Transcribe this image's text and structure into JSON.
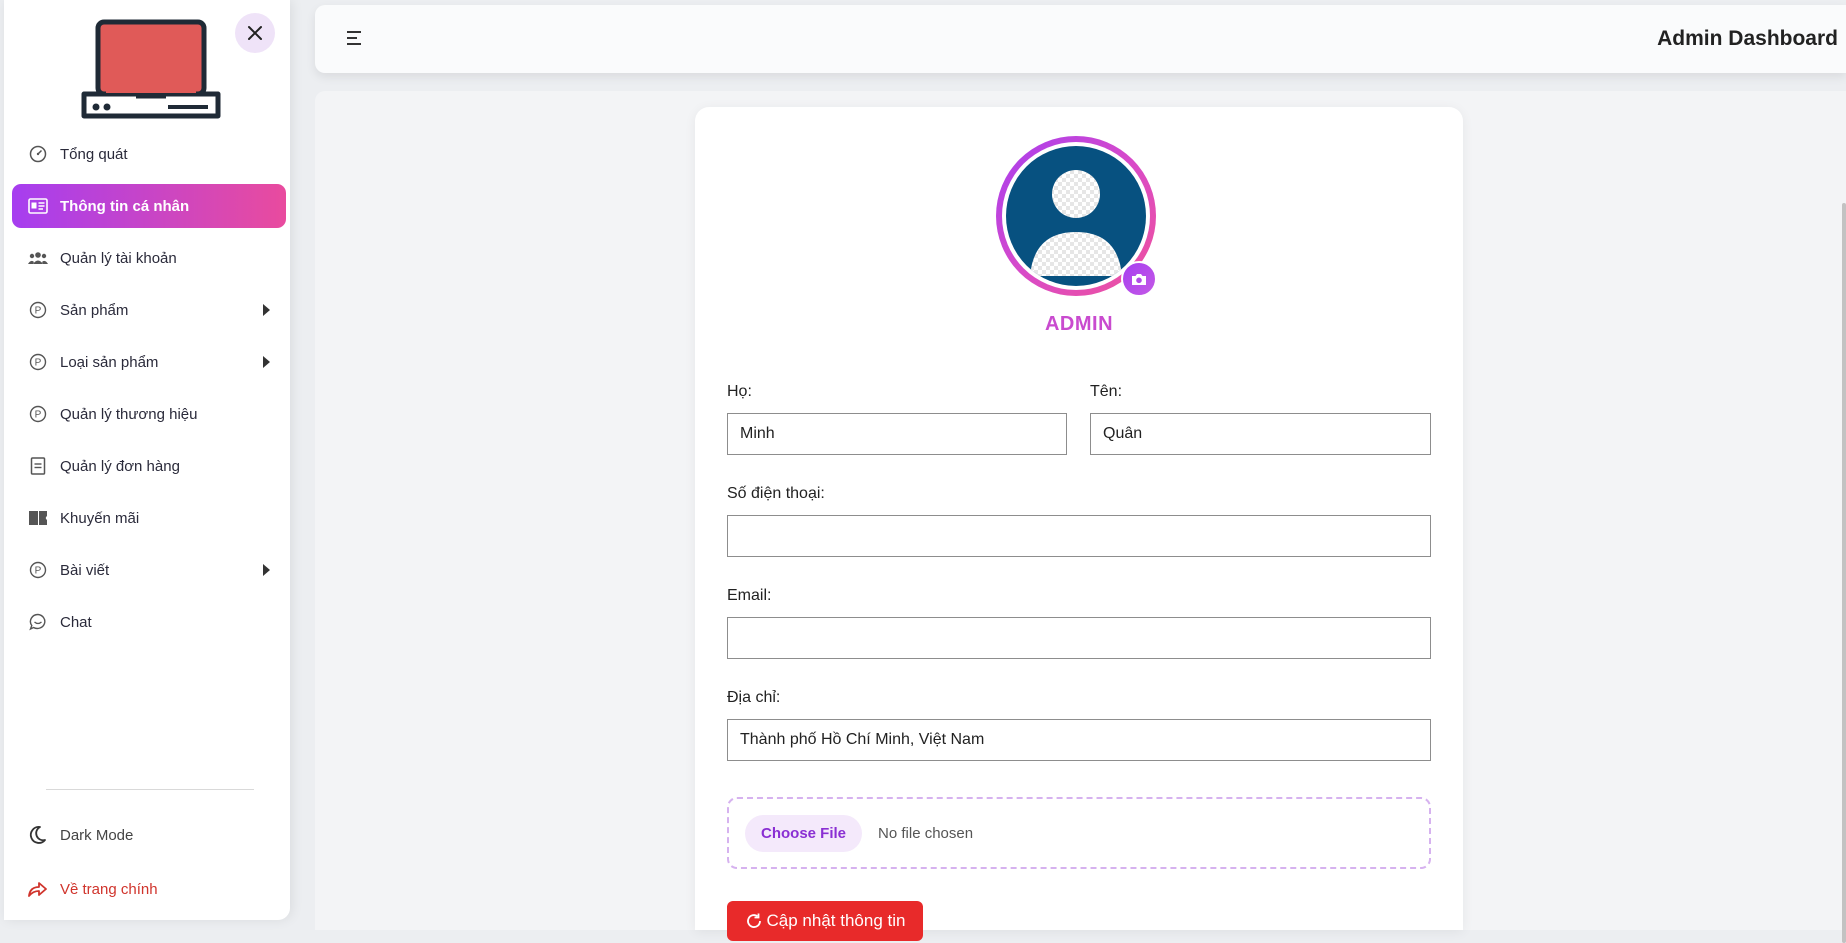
{
  "header": {
    "title": "Admin Dashboard"
  },
  "sidebar": {
    "items": [
      {
        "label": "Tổng quát",
        "icon": "gauge-icon",
        "active": false,
        "submenu": false
      },
      {
        "label": "Thông tin cá nhân",
        "icon": "id-card-icon",
        "active": true,
        "submenu": false
      },
      {
        "label": "Quản lý tài khoản",
        "icon": "users-icon",
        "active": false,
        "submenu": false
      },
      {
        "label": "Sản phẩm",
        "icon": "product-p-icon",
        "active": false,
        "submenu": true
      },
      {
        "label": "Loại sản phẩm",
        "icon": "product-p-icon",
        "active": false,
        "submenu": true
      },
      {
        "label": "Quản lý thương hiệu",
        "icon": "product-p-icon",
        "active": false,
        "submenu": false
      },
      {
        "label": "Quản lý đơn hàng",
        "icon": "document-icon",
        "active": false,
        "submenu": false
      },
      {
        "label": "Khuyến mãi",
        "icon": "ticket-icon",
        "active": false,
        "submenu": false
      },
      {
        "label": "Bài viết",
        "icon": "product-p-icon",
        "active": false,
        "submenu": true
      },
      {
        "label": "Chat",
        "icon": "chat-icon",
        "active": false,
        "submenu": false
      }
    ],
    "dark_mode_label": "Dark Mode",
    "back_home_label": "Về trang chính"
  },
  "profile": {
    "name": "ADMIN",
    "fields": {
      "ho_label": "Họ:",
      "ho_value": "Minh",
      "ten_label": "Tên:",
      "ten_value": "Quân",
      "phone_label": "Số điện thoại:",
      "phone_value": "",
      "email_label": "Email:",
      "email_value": "",
      "address_label": "Địa chỉ:",
      "address_value": "Thành phố Hồ Chí Minh, Việt Nam"
    },
    "file": {
      "button_label": "Choose File",
      "status": "No file chosen"
    },
    "update_label": "Cập nhật thông tin"
  },
  "colors": {
    "accent_gradient_start": "#a63ef0",
    "accent_gradient_end": "#e94b9e",
    "danger": "#e82a2a",
    "avatar_bg": "#075180"
  }
}
